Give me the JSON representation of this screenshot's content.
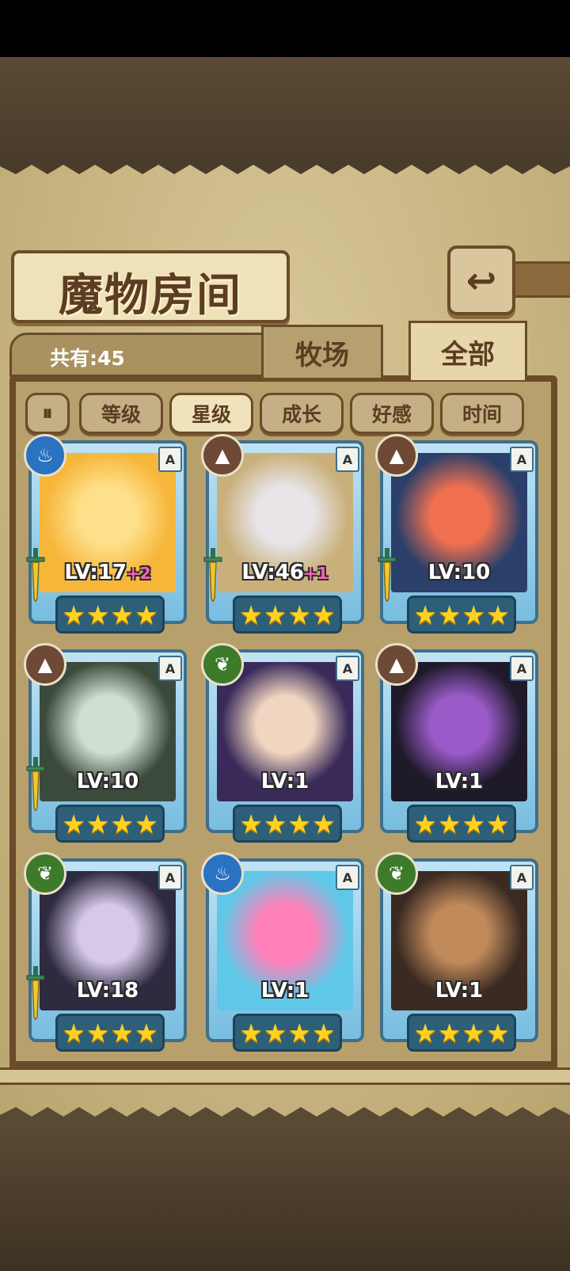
{
  "title": "魔物房间",
  "back_label": "",
  "total": "共有:45",
  "tabs": [
    {
      "label": "牧场",
      "active": false
    },
    {
      "label": "全部",
      "active": true
    }
  ],
  "filters": [
    {
      "label": "等级",
      "selected": false
    },
    {
      "label": "星级",
      "selected": true
    },
    {
      "label": "成长",
      "selected": false
    },
    {
      "label": "好感",
      "selected": false
    },
    {
      "label": "时间",
      "selected": false
    }
  ],
  "cards": [
    {
      "element": "water",
      "rank": "A",
      "level": "LV:17",
      "bonus": "+2",
      "stars": 4,
      "equipped": true,
      "portrait": [
        "#f6b63a",
        "#ffe08a"
      ]
    },
    {
      "element": "earth",
      "rank": "A",
      "level": "LV:46",
      "bonus": "+1",
      "stars": 4,
      "equipped": true,
      "portrait": [
        "#c9b07a",
        "#e8e4e8"
      ]
    },
    {
      "element": "earth",
      "rank": "A",
      "level": "LV:10",
      "bonus": "",
      "stars": 4,
      "equipped": true,
      "portrait": [
        "#2a3f6a",
        "#f07050"
      ]
    },
    {
      "element": "earth",
      "rank": "A",
      "level": "LV:10",
      "bonus": "",
      "stars": 4,
      "equipped": true,
      "portrait": [
        "#3c4a3c",
        "#cfe0d0"
      ]
    },
    {
      "element": "wood",
      "rank": "A",
      "level": "LV:1",
      "bonus": "",
      "stars": 4,
      "equipped": false,
      "portrait": [
        "#3a2a5a",
        "#f0d6c0"
      ]
    },
    {
      "element": "earth",
      "rank": "A",
      "level": "LV:1",
      "bonus": "",
      "stars": 4,
      "equipped": false,
      "portrait": [
        "#1e1a2a",
        "#9a5ac8"
      ]
    },
    {
      "element": "wood",
      "rank": "A",
      "level": "LV:18",
      "bonus": "",
      "stars": 4,
      "equipped": true,
      "portrait": [
        "#2e2a40",
        "#d6c8e8"
      ]
    },
    {
      "element": "water",
      "rank": "A",
      "level": "LV:1",
      "bonus": "",
      "stars": 4,
      "equipped": false,
      "portrait": [
        "#5fc8e8",
        "#ff7fb8"
      ]
    },
    {
      "element": "wood",
      "rank": "A",
      "level": "LV:1",
      "bonus": "",
      "stars": 4,
      "equipped": false,
      "portrait": [
        "#3a2a22",
        "#c08a5a"
      ]
    }
  ]
}
